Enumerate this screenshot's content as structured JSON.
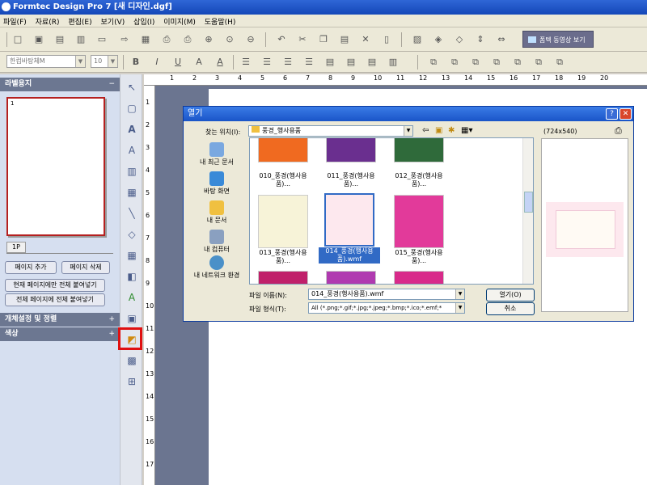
{
  "app": {
    "title": "Formtec Design Pro 7 [새 디자인.dgf]"
  },
  "menu": [
    "파일(F)",
    "자료(R)",
    "편집(E)",
    "보기(V)",
    "삽입(I)",
    "이미지(M)",
    "도움말(H)"
  ],
  "toolbar": {
    "video_button": "폼텍 동영상 보기",
    "font_name": "한컴바탕체M",
    "font_size": "10"
  },
  "left_panel": {
    "label_section_title": "라벨용지",
    "page_number": "1",
    "page_tab": "1P",
    "add_page": "페이지 추가",
    "delete_page": "페이지 삭제",
    "paste_current": "현재 페이지에만 전체 붙여넣기",
    "paste_all": "전체 페이지에 전체 붙여넣기",
    "section2_title": "개체설정 및 정렬",
    "section3_title": "색상"
  },
  "ruler": {
    "h": [
      "1",
      "2",
      "3",
      "4",
      "5",
      "6",
      "7",
      "8",
      "9",
      "10",
      "11",
      "12",
      "13",
      "14",
      "15",
      "16",
      "17",
      "18",
      "19",
      "20"
    ],
    "v": [
      "1",
      "2",
      "3",
      "4",
      "5",
      "6",
      "7",
      "8",
      "9",
      "10",
      "11",
      "12",
      "13",
      "14",
      "15",
      "16",
      "17"
    ]
  },
  "dialog": {
    "title": "열기",
    "look_in_label": "찾는 위치(I):",
    "look_in_value": "풍경_행사용품",
    "preview_size": "(724x540)",
    "places": [
      "내 최근 문서",
      "바탕 화면",
      "내 문서",
      "내 컴퓨터",
      "내 네트워크 환경"
    ],
    "files": [
      {
        "name": "010_풍경(행사용품)...",
        "bg": "#f06a20"
      },
      {
        "name": "011_풍경(행사용품)...",
        "bg": "#6a2f8f"
      },
      {
        "name": "012_풍경(행사용품)...",
        "bg": "#2f6a3a"
      },
      {
        "name": "013_풍경(행사용품)...",
        "bg": "#f7f3d8"
      },
      {
        "name": "014_풍경(행사용품).wmf",
        "bg": "#fde8ee"
      },
      {
        "name": "015_풍경(행사용품)...",
        "bg": "#e23a9a"
      },
      {
        "name": "",
        "bg": "#c0206a"
      },
      {
        "name": "",
        "bg": "#b03ab0"
      },
      {
        "name": "",
        "bg": "#d82a8a"
      }
    ],
    "filename_label": "파일 이름(N):",
    "filename_value": "014_풍경(행사용품).wmf",
    "filetype_label": "파일 형식(T):",
    "filetype_value": "All (*.png;*.gif;*.jpg;*.jpeg;*.bmp;*.ico;*.emf;*",
    "open_button": "열기(O)",
    "cancel_button": "취소"
  }
}
